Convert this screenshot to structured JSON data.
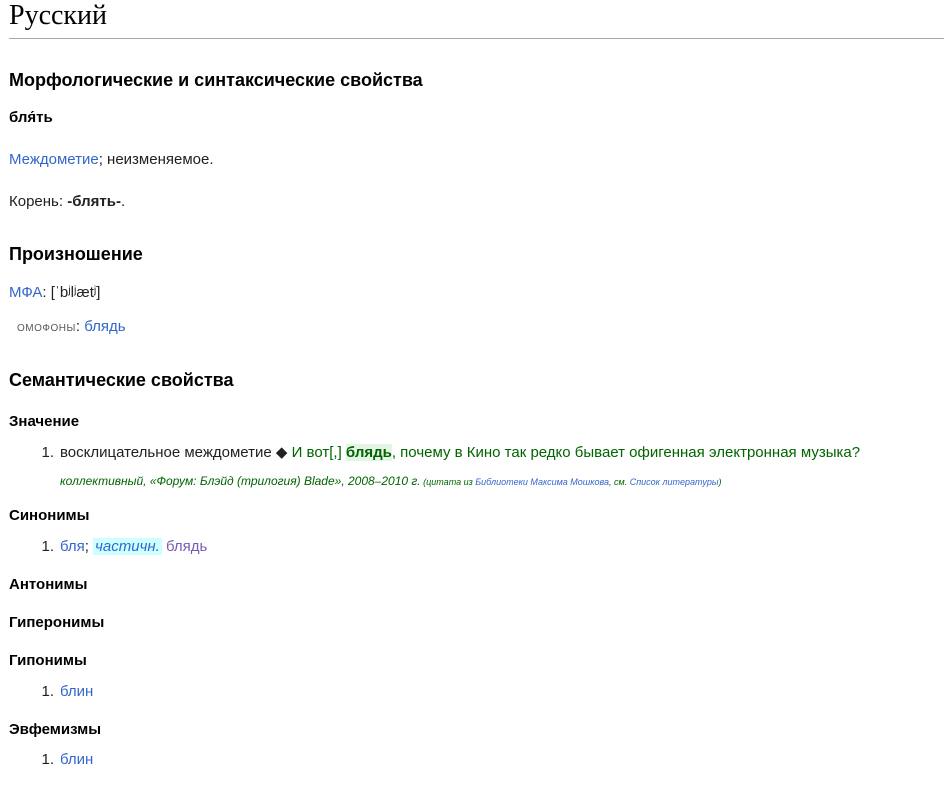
{
  "language_heading": "Русский",
  "morph": {
    "heading": "Морфологические и синтаксические свойства",
    "headword": "бля́ть",
    "pos_link": "Междометие",
    "pos_rest": "; неизменяемое.",
    "root_label": "Корень: ",
    "root_value": "-блять-",
    "root_end": "."
  },
  "pron": {
    "heading": "Произношение",
    "ipa_link": "МФА",
    "ipa_sep": ": ",
    "ipa_value": "[ˈbʲlʲætʲ]",
    "homophones_label": "омофоны",
    "homophones_sep": ": ",
    "homophones_link": "блядь"
  },
  "semantic": {
    "heading": "Семантические свойства",
    "meaning": {
      "heading": "Значение",
      "item_number": "1.",
      "definition": "восклицательное междометие ",
      "diamond": "◆",
      "example_pre": " И вот[,] ",
      "example_bold": "блядь",
      "example_post": ", почему в Кино так редко бывает офигенная электронная музыка?",
      "citation": "коллективный, «Форум: Блэйд (трилогия) Blade», 2008–2010 г.",
      "cite_open": " (цитата из ",
      "cite_link1": "Библиотеки Максима Мошкова",
      "cite_mid": ", см. ",
      "cite_link2": "Список литературы",
      "cite_close": ")"
    },
    "synonyms": {
      "heading": "Синонимы",
      "item_number": "1.",
      "link1": "бля",
      "sep": "; ",
      "label": "частичн.",
      "link2": "блядь"
    },
    "antonyms": {
      "heading": "Антонимы"
    },
    "hypernyms": {
      "heading": "Гиперонимы"
    },
    "hyponyms": {
      "heading": "Гипонимы",
      "item_number": "1.",
      "link": "блин"
    },
    "euphemisms": {
      "heading": "Эвфемизмы",
      "item_number": "1.",
      "link": "блин"
    }
  },
  "colors": {
    "link": "#3366cc",
    "visited_link": "#795cb2",
    "example": "#006400",
    "label_highlight": "#ccffff"
  }
}
